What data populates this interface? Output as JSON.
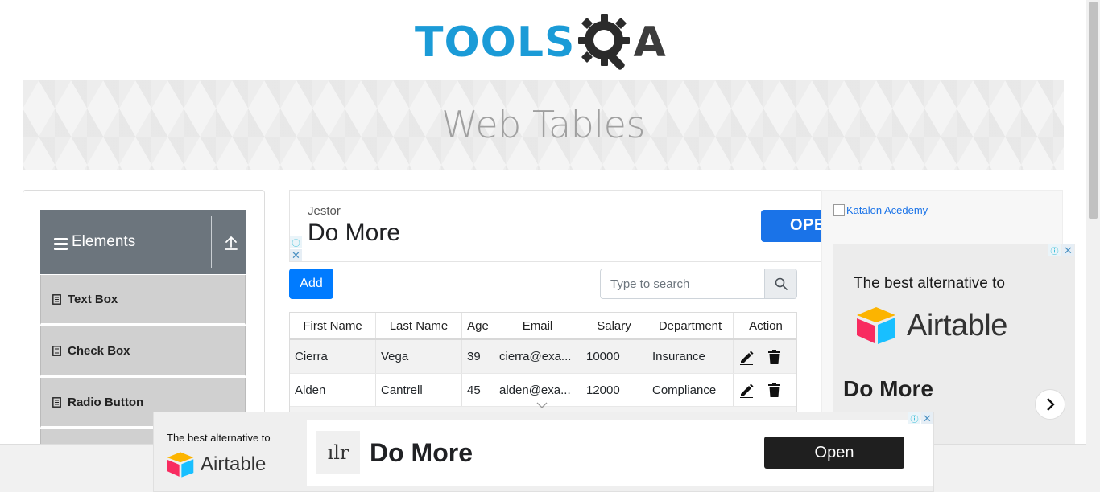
{
  "header": {
    "logo_text_primary": "TOOLS",
    "logo_text_secondary": "A",
    "page_title": "Web Tables"
  },
  "sidebar": {
    "group_title": "Elements",
    "items": [
      {
        "label": "Text Box"
      },
      {
        "label": "Check Box"
      },
      {
        "label": "Radio Button"
      }
    ]
  },
  "ad_top": {
    "sponsor": "Jestor",
    "headline": "Do More",
    "button": "OPE"
  },
  "toolbar": {
    "add_label": "Add",
    "search_placeholder": "Type to search"
  },
  "table": {
    "headers": [
      "First Name",
      "Last Name",
      "Age",
      "Email",
      "Salary",
      "Department",
      "Action"
    ],
    "rows": [
      {
        "first": "Cierra",
        "last": "Vega",
        "age": "39",
        "email": "cierra@exa...",
        "salary": "10000",
        "department": "Insurance"
      },
      {
        "first": "Alden",
        "last": "Cantrell",
        "age": "45",
        "email": "alden@exa...",
        "salary": "12000",
        "department": "Compliance"
      }
    ]
  },
  "right_ad": {
    "image_alt": "Katalon Acedemy",
    "tagline": "The best alternative to",
    "brand": "Airtable",
    "headline": "Do More"
  },
  "bottom_ad": {
    "tagline": "The best alternative to",
    "brand": "Airtable",
    "headline": "Do More",
    "button": "Open"
  },
  "colors": {
    "brand_blue": "#1b9bd7",
    "primary_button": "#007bff",
    "menu_header": "#6c757d",
    "menu_item": "#d0d0d0"
  }
}
